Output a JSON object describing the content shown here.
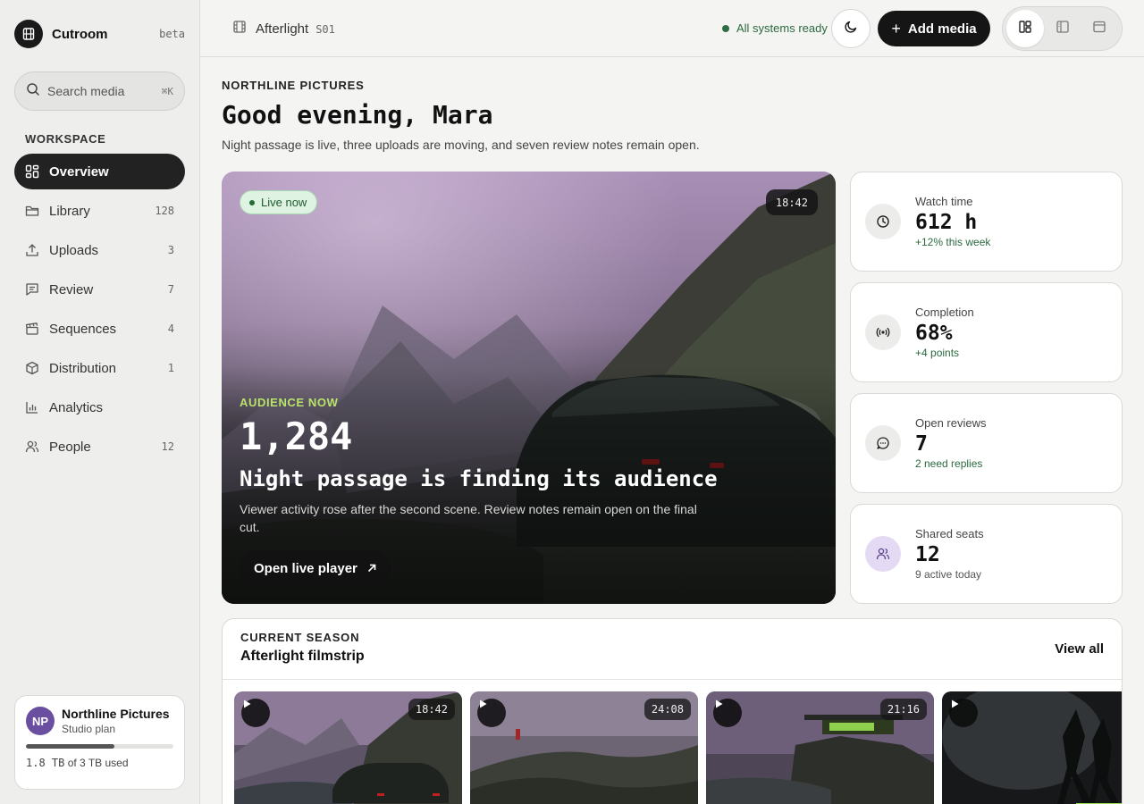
{
  "sidebar": {
    "brand_name": "Cutroom",
    "brand_badge": "beta",
    "search": {
      "placeholder": "Search media",
      "shortcut": "⌘K"
    },
    "section_label": "WORKSPACE",
    "items": [
      {
        "label": "Overview",
        "count": "",
        "icon": "grid-icon",
        "active": true
      },
      {
        "label": "Library",
        "count": "128",
        "icon": "folder-icon"
      },
      {
        "label": "Uploads",
        "count": "3",
        "icon": "upload-icon"
      },
      {
        "label": "Review",
        "count": "7",
        "icon": "comment-icon"
      },
      {
        "label": "Sequences",
        "count": "4",
        "icon": "clapperboard-icon"
      },
      {
        "label": "Distribution",
        "count": "1",
        "icon": "package-icon"
      },
      {
        "label": "Analytics",
        "count": "",
        "icon": "bar-chart-icon"
      },
      {
        "label": "People",
        "count": "12",
        "icon": "users-icon"
      }
    ],
    "plan": {
      "initials": "NP",
      "name": "Northline Pictures",
      "tier": "Studio plan",
      "used_value": "1.8 TB",
      "used_suffix": " of 3 TB used",
      "usage_fraction": 0.6
    }
  },
  "topbar": {
    "project_name": "Afterlight",
    "project_code": "S01",
    "status": "All systems ready",
    "add_label": "Add media",
    "view_modes": [
      "layout-split-icon",
      "layout-sidebar-icon",
      "layout-window-icon"
    ]
  },
  "main": {
    "eyebrow": "NORTHLINE PICTURES",
    "greeting": "Good evening, Mara",
    "subtitle": "Night passage is live, three uploads are moving, and seven review notes remain open."
  },
  "hero": {
    "live_label": "Live now",
    "duration": "18:42",
    "eyebrow": "AUDIENCE NOW",
    "audience": "1,284",
    "title": "Night passage is finding its audience",
    "description": "Viewer activity rose after the second scene. Review notes remain open on the final cut.",
    "button": "Open live player"
  },
  "stats": [
    {
      "label": "Watch time",
      "value": "612 h",
      "delta": "+12% this week",
      "icon": "clock-icon"
    },
    {
      "label": "Completion",
      "value": "68%",
      "delta": "+4 points",
      "icon": "broadcast-icon"
    },
    {
      "label": "Open reviews",
      "value": "7",
      "delta": "2 need replies",
      "icon": "message-icon"
    },
    {
      "label": "Shared seats",
      "value": "12",
      "delta": "9 active today",
      "icon": "users-icon"
    }
  ],
  "season": {
    "eyebrow": "CURRENT SEASON",
    "title": "Afterlight filmstrip",
    "view_all": "View all",
    "episodes": [
      {
        "duration": "18:42"
      },
      {
        "duration": "24:08"
      },
      {
        "duration": "21:16"
      },
      {
        "duration": ""
      }
    ]
  },
  "colors": {
    "accent_dark": "#151515",
    "status_green": "#2a6a3e",
    "audience_green": "#b8e36a",
    "avatar_purple": "#6a4ea0"
  }
}
